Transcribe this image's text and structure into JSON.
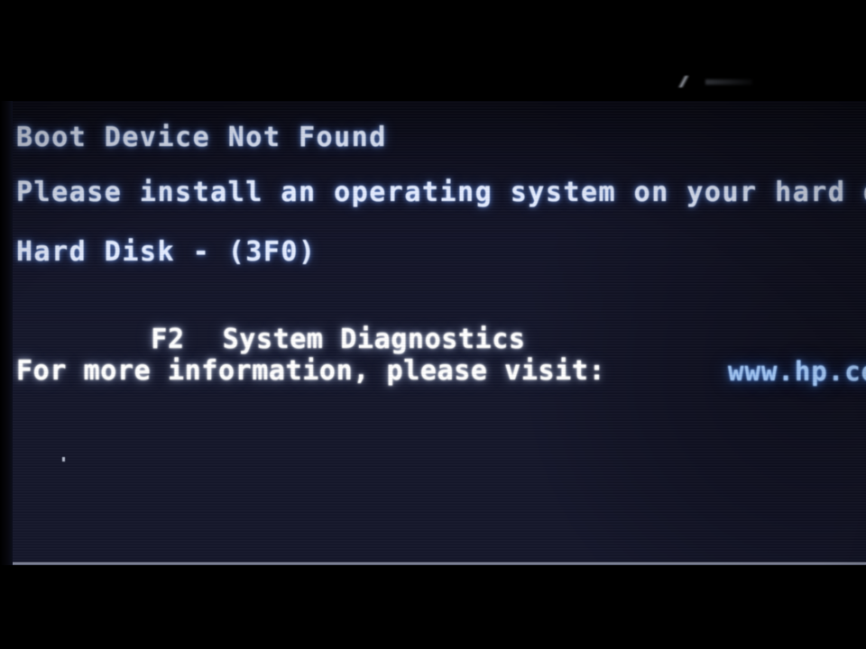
{
  "screen": {
    "kind": "bios-boot-error",
    "vendor_hint": "HP",
    "background_colors": {
      "glow_center": "#8e99c2",
      "panel_dark": "#1d1f35",
      "letterbox": "#000000"
    },
    "text_colors": {
      "primary": "#e4ecff",
      "emphasis": "#ffffff",
      "url": "#9fc2ef"
    }
  },
  "messages": {
    "title": "Boot Device Not Found",
    "instruction": "Please install an operating system on your hard disk.",
    "device": "Hard Disk - (3F0)",
    "more_info": "For more information, please visit:",
    "url": "www.hp.com"
  },
  "key_options": [
    {
      "key": "F2",
      "label": "System Diagnostics"
    }
  ]
}
